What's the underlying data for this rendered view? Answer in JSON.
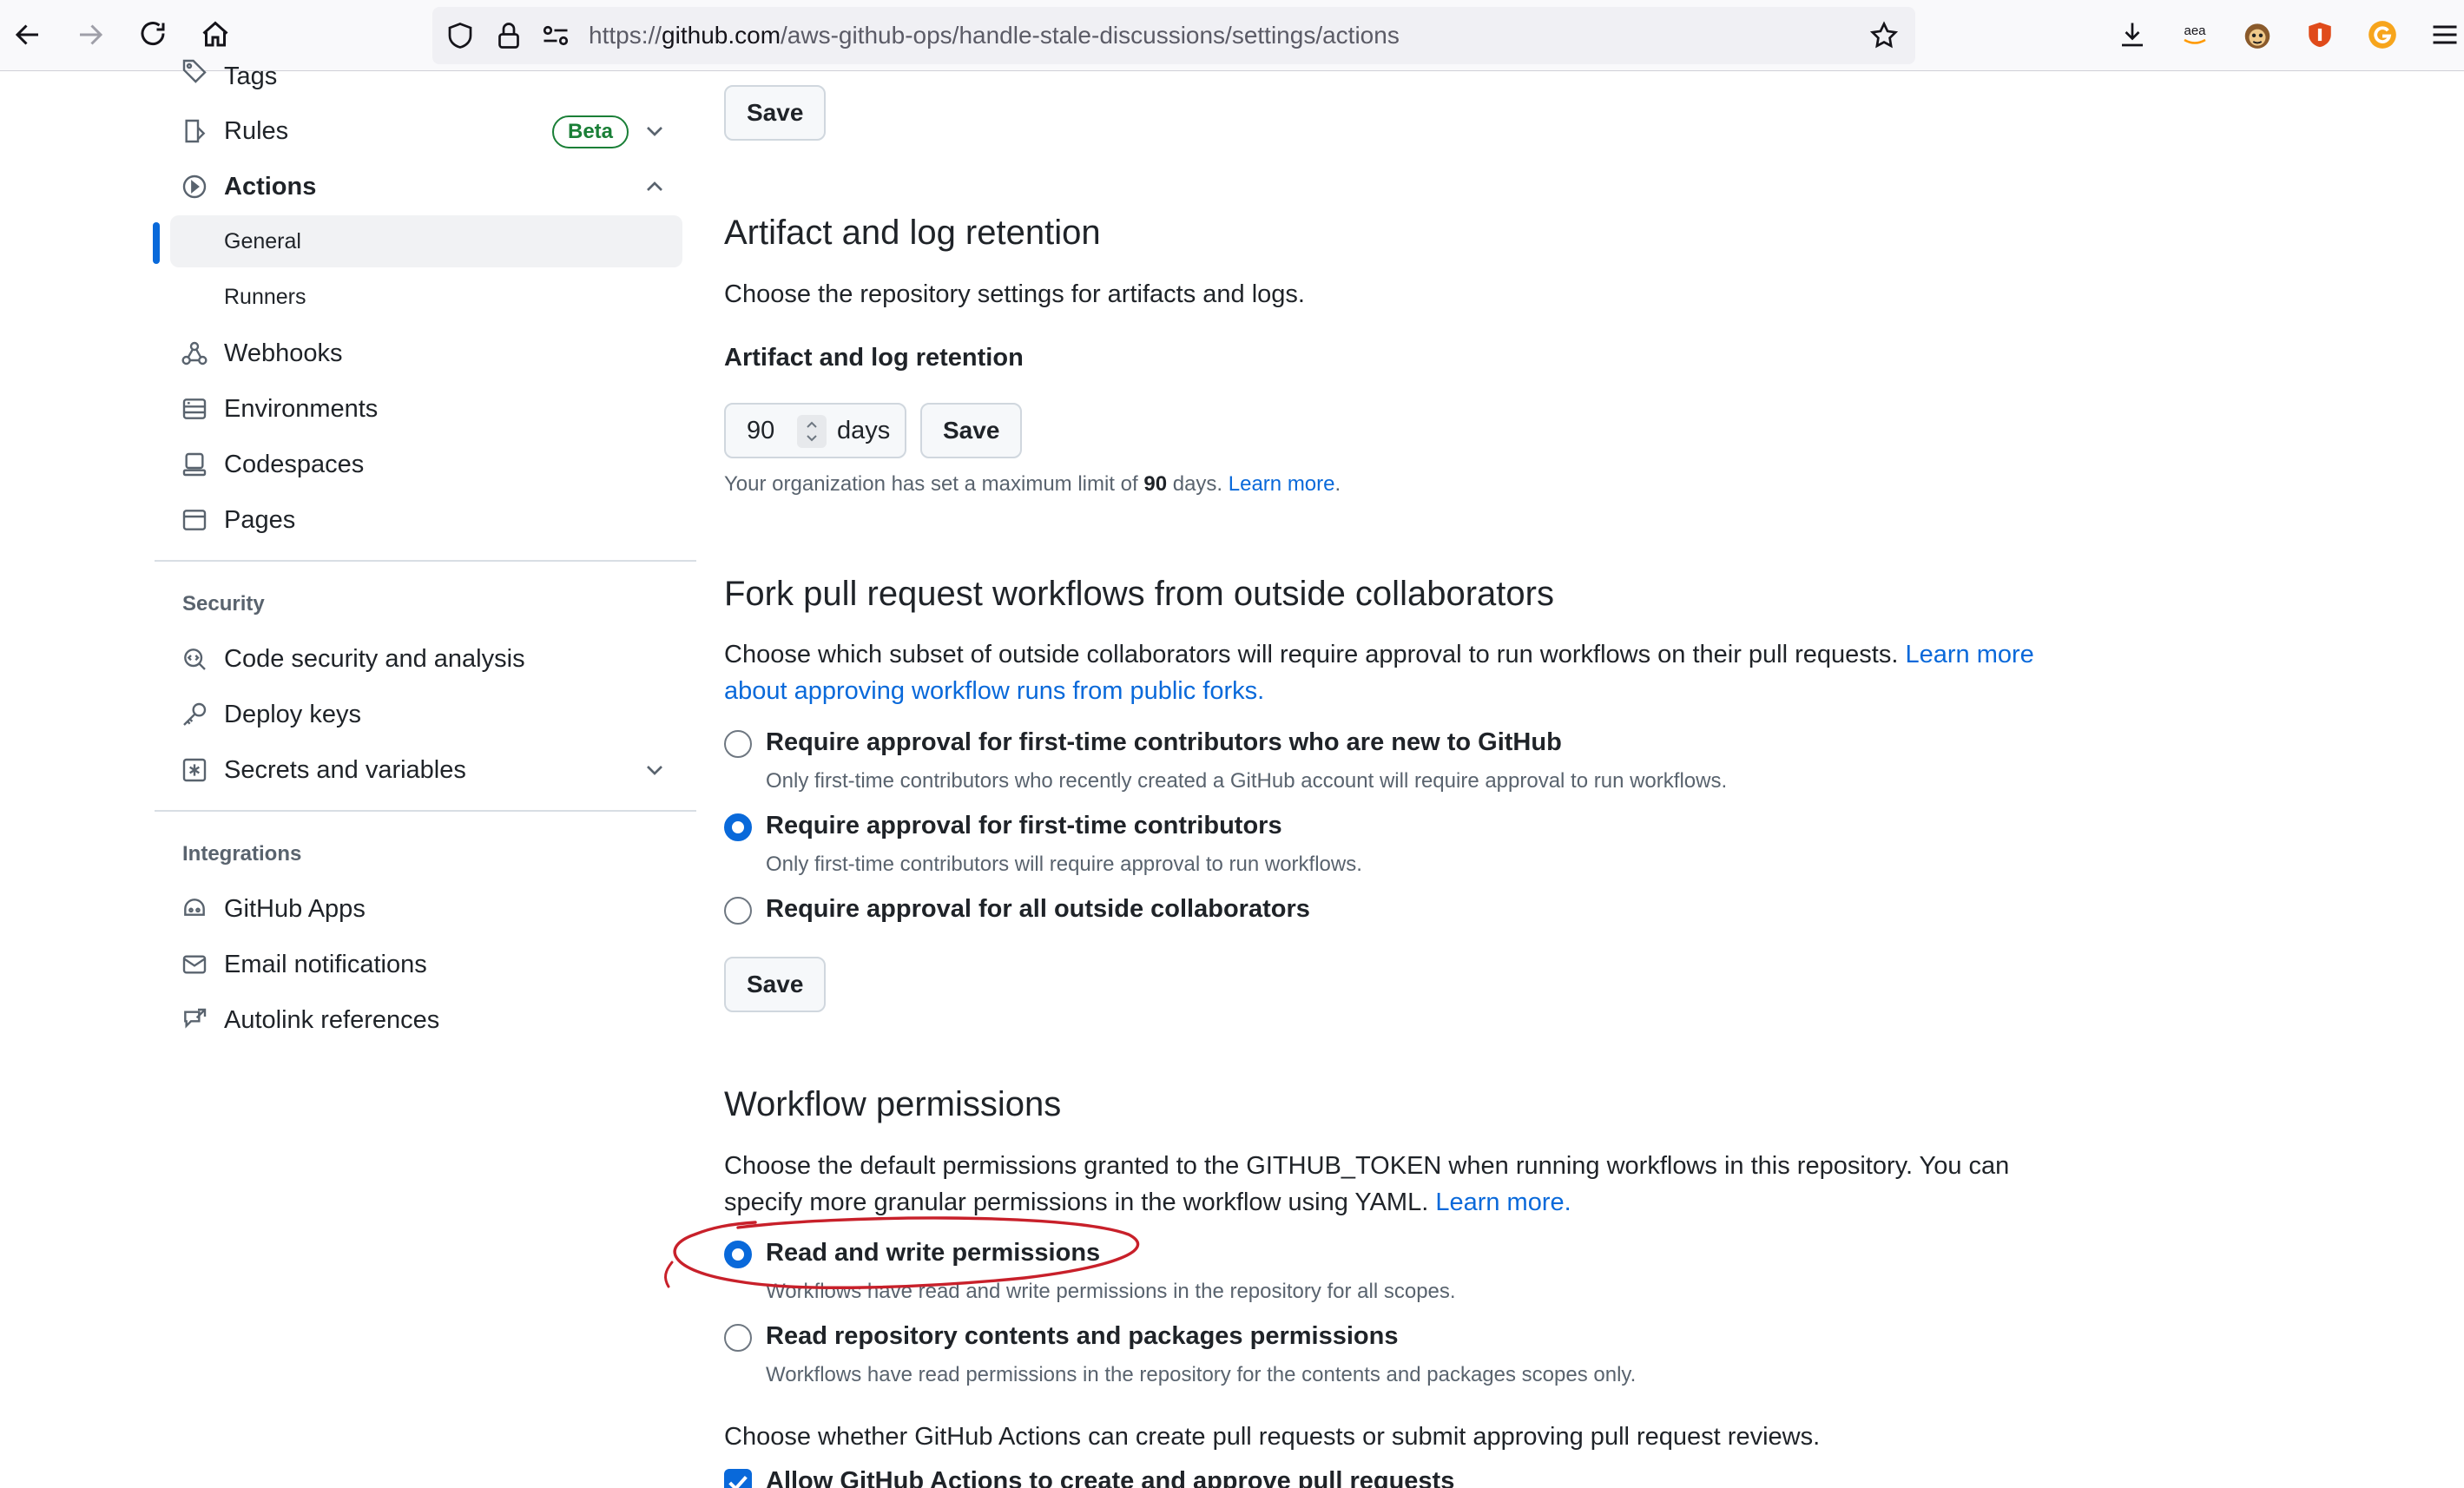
{
  "browser": {
    "url_prefix": "https://",
    "url_host": "github.com",
    "url_path": "/aws-github-ops/handle-stale-discussions/settings/actions",
    "ext_aea": "aea"
  },
  "sidebar": {
    "tags_label": "Tags",
    "rules_label": "Rules",
    "beta_badge": "Beta",
    "actions_label": "Actions",
    "general_label": "General",
    "runners_label": "Runners",
    "webhooks_label": "Webhooks",
    "environments_label": "Environments",
    "codespaces_label": "Codespaces",
    "pages_label": "Pages",
    "security_heading": "Security",
    "code_security_label": "Code security and analysis",
    "deploy_keys_label": "Deploy keys",
    "secrets_label": "Secrets and variables",
    "integrations_heading": "Integrations",
    "github_apps_label": "GitHub Apps",
    "email_notifications_label": "Email notifications",
    "autolink_label": "Autolink references"
  },
  "main": {
    "save_label": "Save",
    "artifact": {
      "title": "Artifact and log retention",
      "description": "Choose the repository settings for artifacts and logs.",
      "field_label": "Artifact and log retention",
      "days_value": "90",
      "days_unit": "days",
      "note_prefix": "Your organization has set a maximum limit of",
      "note_value": "90",
      "note_suffix": "days.",
      "learn_more": "Learn more"
    },
    "fork": {
      "title": "Fork pull request workflows from outside collaborators",
      "description_line1": "Choose which subset of outside collaborators will require approval to run workflows on their pull requests.",
      "link_part1": "Learn",
      "link_part2": "more about approving workflow runs from public forks.",
      "options": [
        {
          "title": "Require approval for first-time contributors who are new to GitHub",
          "desc": "Only first-time contributors who recently created a GitHub account will require approval to run workflows.",
          "checked": false
        },
        {
          "title": "Require approval for first-time contributors",
          "desc": "Only first-time contributors will require approval to run workflows.",
          "checked": true
        },
        {
          "title": "Require approval for all outside collaborators",
          "desc": "",
          "checked": false
        }
      ]
    },
    "workflow": {
      "title": "Workflow permissions",
      "description_line1": "Choose the default permissions granted to the GITHUB_TOKEN when running workflows in this repository. You can",
      "description_line2": "specify more granular permissions in the workflow using YAML.",
      "learn_more": "Learn more.",
      "options": [
        {
          "title": "Read and write permissions",
          "desc": "Workflows have read and write permissions in the repository for all scopes.",
          "checked": true
        },
        {
          "title": "Read repository contents and packages permissions",
          "desc": "Workflows have read permissions in the repository for the contents and packages scopes only.",
          "checked": false
        }
      ],
      "pr_question": "Choose whether GitHub Actions can create pull requests or submit approving pull request reviews.",
      "allow_pr_label": "Allow GitHub Actions to create and approve pull requests",
      "allow_pr_checked": true
    }
  },
  "colors": {
    "accent": "#0969da",
    "beta_green": "#1a7f37",
    "annotation_red": "#c8202a"
  }
}
